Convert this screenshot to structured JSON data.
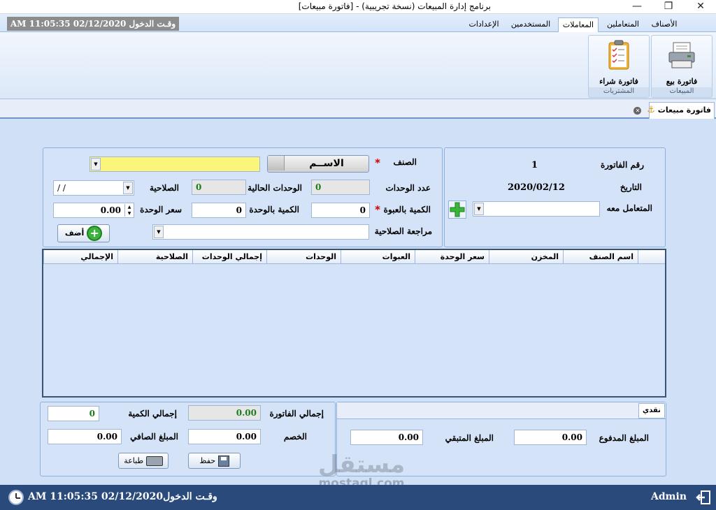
{
  "window": {
    "title": "برنامج إدارة المبيعات (نسخة تجريبية) - [فاتورة مبيعات]",
    "buttons": [
      "—",
      "❐",
      "✕"
    ]
  },
  "tabs": {
    "login_time": "وقـت الدخول 02/12/2020 11:05:35 AM",
    "items": [
      "الأصناف",
      "المتعاملين",
      "المعاملات",
      "المستخدمين",
      "الإعدادات"
    ],
    "active": "المعاملات"
  },
  "ribbon": {
    "group_sales": "المبيعات",
    "btn_sales_invoice": "فاتورة بيع",
    "group_purchases": "المشتريات",
    "btn_purchase_invoice": "فاتورة شراء"
  },
  "doc_tab": {
    "label": "فاتورة مبيعات"
  },
  "invoice": {
    "number_label": "رقم الفاتورة",
    "number_value": "1",
    "date_label": "التاريخ",
    "date_value": "2020/02/12",
    "client_label": "المتعامل معه",
    "client_value": ""
  },
  "item_form": {
    "item_label": "الصنف",
    "name_button": "الاســم",
    "item_value": "",
    "units_count_label": "عدد الوحدات",
    "units_count_value": "0",
    "current_units_label": "الوحدات الحالية",
    "current_units_value": "0",
    "validity_label": "الصلاحية",
    "validity_value": "/   /",
    "qty_pack_label": "الكمية بالعبوة",
    "qty_pack_value": "0",
    "qty_unit_label": "الكمية بالوحدة",
    "qty_unit_value": "0",
    "unit_price_label": "سعر الوحدة",
    "unit_price_value": "0.00",
    "validity_review_label": "مراجعة الصلاحية",
    "validity_review_value": "",
    "add_button": "أضف"
  },
  "grid": {
    "columns": [
      "اسم الصنف",
      "المخزن",
      "سعر الوحدة",
      "العبوات",
      "الوحدات",
      "إجمالي الوحدات",
      "الصلاحية",
      "الإجمالي"
    ]
  },
  "payment": {
    "tab_label": "نقدي",
    "paid_label": "المبلغ المدفوع",
    "paid_value": "0.00",
    "remaining_label": "المبلغ المتبقي",
    "remaining_value": "0.00"
  },
  "totals": {
    "invoice_total_label": "إجمالي الفاتورة",
    "invoice_total_value": "0.00",
    "qty_total_label": "إجمالي الكمية",
    "qty_total_value": "0",
    "discount_label": "الخصم",
    "discount_value": "0.00",
    "net_label": "المبلغ الصافي",
    "net_value": "0.00",
    "save_button": "حفظ",
    "print_button": "طباعة"
  },
  "statusbar": {
    "time": "وقـت الدخول02/12/2020 11:05:35 AM",
    "user": "Admin"
  },
  "watermark": {
    "arabic": "مستقل",
    "latin": "mostaql.com"
  }
}
